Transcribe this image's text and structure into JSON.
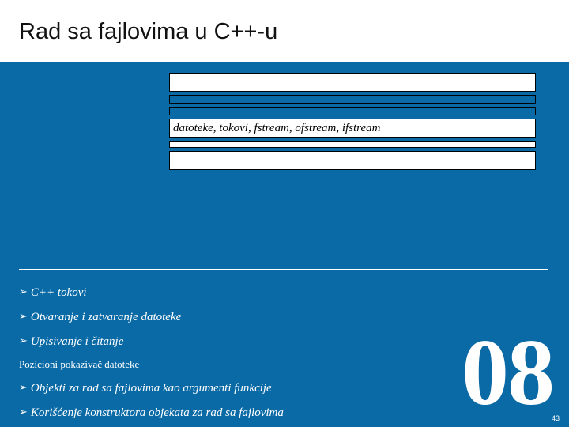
{
  "title": "Rad sa fajlovima u C++-u",
  "keywords": "datoteke, tokovi, fstream, ofstream, ifstream",
  "bullets": [
    "C++ tokovi",
    "Otvaranje i zatvaranje datoteke",
    "Upisivanje i čitanje",
    "Pozicioni pokazivač datoteke",
    "Objekti za rad sa fajlovima kao argumenti funkcije",
    "Korišćenje konstruktora objekata za rad sa fajlovima"
  ],
  "chapter_number": "08",
  "page_number": "43",
  "bullet_marker": "➢"
}
